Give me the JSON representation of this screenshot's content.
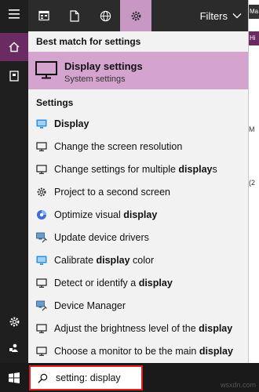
{
  "filters_label": "Filters",
  "best_match": {
    "heading": "Best match for settings",
    "title": "Display settings",
    "subtitle": "System settings"
  },
  "settings_heading": "Settings",
  "settings_items": [
    {
      "icon": "display-icon",
      "pre": "",
      "bold": "Display",
      "post": ""
    },
    {
      "icon": "monitor-icon",
      "pre": "Change the screen resolution",
      "bold": "",
      "post": ""
    },
    {
      "icon": "monitor-icon",
      "pre": "Change settings for multiple ",
      "bold": "display",
      "post": "s"
    },
    {
      "icon": "gear-icon",
      "pre": "Project to a second screen",
      "bold": "",
      "post": ""
    },
    {
      "icon": "color-circle-icon",
      "pre": "Optimize visual ",
      "bold": "display",
      "post": ""
    },
    {
      "icon": "device-tools-icon",
      "pre": "Update device drivers",
      "bold": "",
      "post": ""
    },
    {
      "icon": "display-icon",
      "pre": "Calibrate ",
      "bold": "display",
      "post": " color"
    },
    {
      "icon": "monitor-icon",
      "pre": "Detect or identify a ",
      "bold": "display",
      "post": ""
    },
    {
      "icon": "device-tools-icon",
      "pre": "Device Manager",
      "bold": "",
      "post": ""
    },
    {
      "icon": "monitor-icon",
      "pre": "Adjust the brightness level of the ",
      "bold": "display",
      "post": ""
    },
    {
      "icon": "monitor-icon",
      "pre": "Choose a monitor to be the main ",
      "bold": "display",
      "post": ""
    }
  ],
  "search": {
    "query": "setting: display"
  },
  "background_fragments": [
    "Ma",
    "Hi",
    "M",
    "(2"
  ],
  "watermark": "wsxdn.com",
  "colors": {
    "accent_selected": "#d4a4cf",
    "accent_dark": "#6a2a62",
    "search_outline": "#dd2222"
  }
}
